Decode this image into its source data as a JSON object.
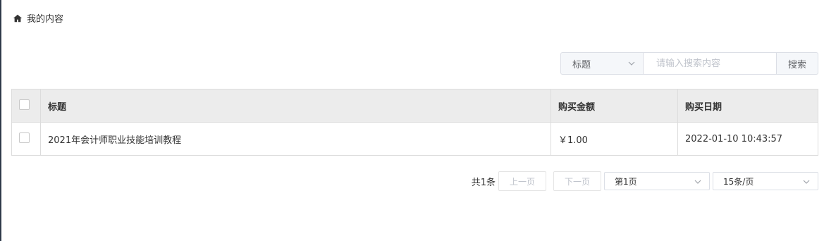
{
  "breadcrumb": {
    "icon": "home-icon",
    "label": "我的内容"
  },
  "search": {
    "field_selected": "标题",
    "placeholder": "请输入搜索内容",
    "button_label": "搜索"
  },
  "table": {
    "columns": [
      "标题",
      "购买金额",
      "购买日期"
    ],
    "rows": [
      {
        "title": "2021年会计师职业技能培训教程",
        "amount": "￥1.00",
        "date": "2022-01-10 10:43:57"
      }
    ]
  },
  "pagination": {
    "total_label": "共1条",
    "prev_label": "上一页",
    "next_label": "下一页",
    "page_selected": "第1页",
    "page_size_selected": "15条/页"
  }
}
